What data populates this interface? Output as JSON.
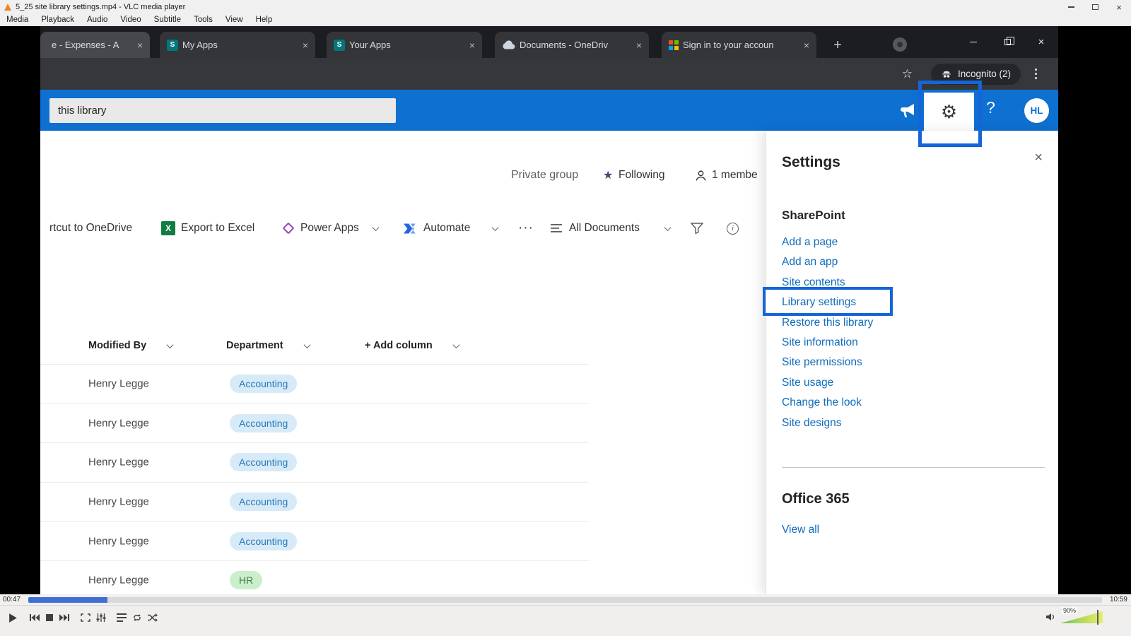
{
  "vlc": {
    "window_title": "5_25 site library settings.mp4 - VLC media player",
    "menu_items": [
      "Media",
      "Playback",
      "Audio",
      "Video",
      "Subtitle",
      "Tools",
      "View",
      "Help"
    ],
    "elapsed": "00:47",
    "duration": "10:59",
    "volume": "90%"
  },
  "browser": {
    "tabs": [
      {
        "title": "e - Expenses - A"
      },
      {
        "title": "My Apps"
      },
      {
        "title": "Your Apps"
      },
      {
        "title": "Documents - OneDriv"
      },
      {
        "title": "Sign in to your accoun"
      }
    ],
    "incognito_label": "Incognito (2)"
  },
  "suitebar": {
    "search_value": "this library",
    "avatar_initials": "HL"
  },
  "page": {
    "privacy": "Private group",
    "following": "Following",
    "members": "1 membe",
    "commands": {
      "shortcut": "rtcut to OneDrive",
      "export_excel": "Export to Excel",
      "power_apps": "Power Apps",
      "automate": "Automate",
      "more": "···",
      "view_selector": "All Documents"
    },
    "table": {
      "headers": [
        "Modified By",
        "Department",
        "+ Add column"
      ],
      "rows": [
        {
          "modified_by": "Henry Legge",
          "department": "Accounting",
          "tone": "blue"
        },
        {
          "modified_by": "Henry Legge",
          "department": "Accounting",
          "tone": "blue"
        },
        {
          "modified_by": "Henry Legge",
          "department": "Accounting",
          "tone": "blue"
        },
        {
          "modified_by": "Henry Legge",
          "department": "Accounting",
          "tone": "blue"
        },
        {
          "modified_by": "Henry Legge",
          "department": "Accounting",
          "tone": "blue"
        },
        {
          "modified_by": "Henry Legge",
          "department": "HR",
          "tone": "green"
        }
      ]
    }
  },
  "settings_panel": {
    "title": "Settings",
    "sharepoint_header": "SharePoint",
    "sharepoint_links": [
      "Add a page",
      "Add an app",
      "Site contents",
      "Library settings",
      "Restore this library",
      "Site information",
      "Site permissions",
      "Site usage",
      "Change the look",
      "Site designs"
    ],
    "office_header": "Office 365",
    "view_all": "View all",
    "highlighted_link": "Library settings"
  },
  "icons": {
    "close": "×",
    "sharepoint": "S",
    "excel": "X",
    "plus": "+",
    "gear": "⚙",
    "question": "?",
    "star_outline": "☆",
    "star_filled": "★",
    "info": "i"
  },
  "colors": {
    "suite_blue": "#0e70d1",
    "annotation_blue": "#1565d8",
    "link_blue": "#0f6cbd",
    "pill_blue_bg": "#d6eaf8",
    "pill_blue_text": "#2a79b8",
    "pill_green_bg": "#cbeecb",
    "pill_green_text": "#41804a"
  }
}
